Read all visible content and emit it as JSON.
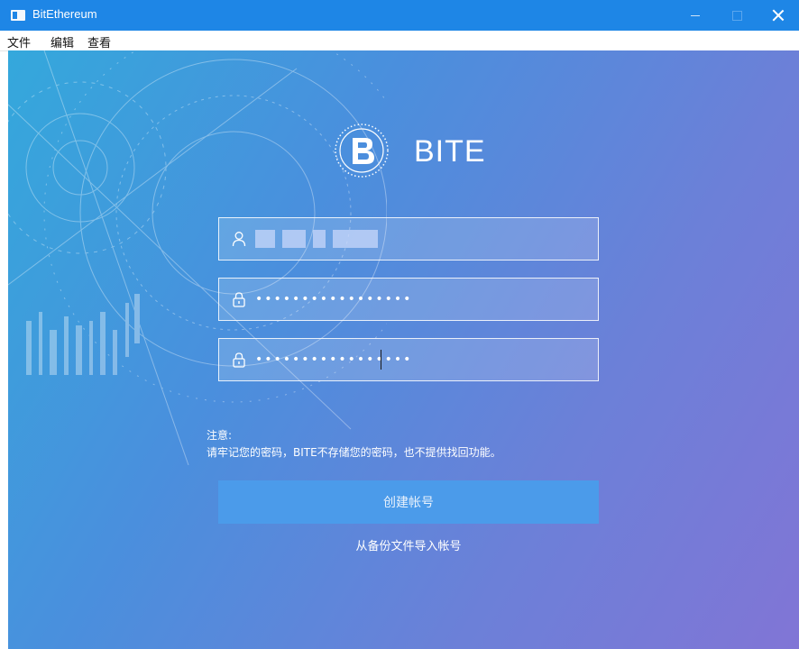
{
  "window": {
    "title": "BitEthereum",
    "accent_color": "#1e86e6",
    "controls": {
      "minimize_icon": "minimize-icon",
      "maximize_icon": "maximize-icon",
      "close_icon": "close-icon"
    }
  },
  "menu": {
    "items": [
      {
        "label": "文件"
      },
      {
        "label": "编辑"
      },
      {
        "label": "查看"
      }
    ]
  },
  "logo": {
    "text": "BITE",
    "mark_letter": "B"
  },
  "form": {
    "username": {
      "value": "",
      "icon": "user-icon",
      "obscured": true
    },
    "password": {
      "value": "•••••••••••••••••",
      "icon": "lock-icon"
    },
    "confirm_password": {
      "value": "•••••••••••••••••",
      "icon": "lock-icon"
    }
  },
  "notice": {
    "title": "注意:",
    "text": "请牢记您的密码，BITE不存储您的密码，也不提供找回功能。"
  },
  "actions": {
    "create_account": "创建帐号",
    "import_backup": "从备份文件导入帐号"
  }
}
